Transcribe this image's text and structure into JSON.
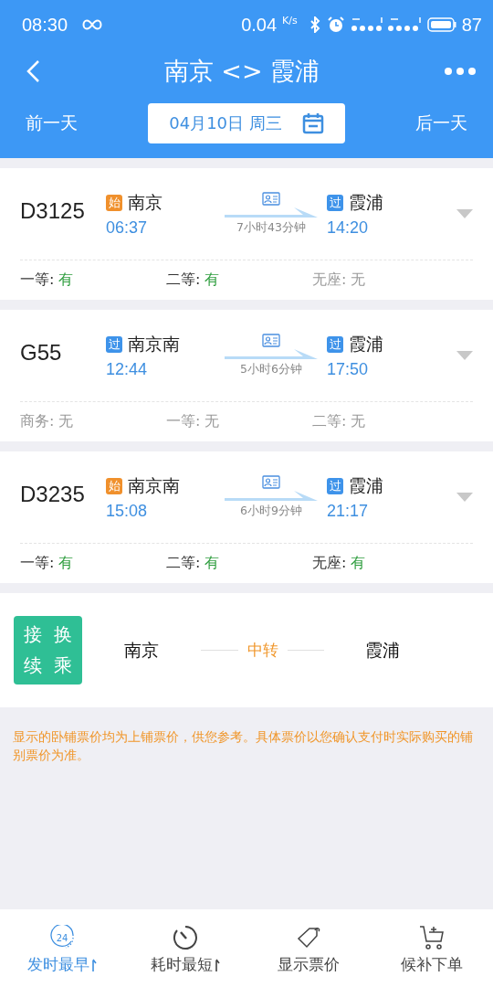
{
  "status_bar": {
    "time": "08:30",
    "speed": "0.04",
    "speed_unit": "K/s",
    "battery": "87"
  },
  "header": {
    "title": "南京 <> 霞浦"
  },
  "date_bar": {
    "prev": "前一天",
    "date": "04月10日 周三",
    "next": "后一天"
  },
  "trains": [
    {
      "number": "D3125",
      "from": {
        "badge": "始",
        "kind": "start",
        "station": "南京",
        "time": "06:37"
      },
      "duration": "7小时43分钟",
      "to": {
        "badge": "过",
        "kind": "pass",
        "station": "霞浦",
        "time": "14:20"
      },
      "seats": [
        {
          "label": "一等:",
          "value": "有",
          "available": true
        },
        {
          "label": "二等:",
          "value": "有",
          "available": true
        },
        {
          "label": "无座:",
          "value": "无",
          "available": false
        }
      ]
    },
    {
      "number": "G55",
      "from": {
        "badge": "过",
        "kind": "pass",
        "station": "南京南",
        "time": "12:44"
      },
      "duration": "5小时6分钟",
      "to": {
        "badge": "过",
        "kind": "pass",
        "station": "霞浦",
        "time": "17:50"
      },
      "seats": [
        {
          "label": "商务:",
          "value": "无",
          "available": false
        },
        {
          "label": "一等:",
          "value": "无",
          "available": false
        },
        {
          "label": "二等:",
          "value": "无",
          "available": false
        }
      ]
    },
    {
      "number": "D3235",
      "from": {
        "badge": "始",
        "kind": "start",
        "station": "南京南",
        "time": "15:08"
      },
      "duration": "6小时9分钟",
      "to": {
        "badge": "过",
        "kind": "pass",
        "station": "霞浦",
        "time": "21:17"
      },
      "seats": [
        {
          "label": "一等:",
          "value": "有",
          "available": true
        },
        {
          "label": "二等:",
          "value": "有",
          "available": true
        },
        {
          "label": "无座:",
          "value": "有",
          "available": true
        }
      ]
    }
  ],
  "transfer": {
    "badge": [
      "接",
      "换",
      "续",
      "乘"
    ],
    "from": "南京",
    "via": "中转",
    "to": "霞浦"
  },
  "note": "显示的卧铺票价均为上铺票价，供您参考。具体票价以您确认支付时实际购买的铺别票价为准。",
  "bottom_tabs": [
    {
      "label": "发时最早",
      "kind": "clock24",
      "icon_text": "24",
      "sortable": true,
      "selected": true
    },
    {
      "label": "耗时最短",
      "kind": "timer",
      "sortable": true,
      "selected": false
    },
    {
      "label": "显示票价",
      "kind": "tag",
      "sortable": false,
      "selected": false
    },
    {
      "label": "候补下单",
      "kind": "cart",
      "sortable": false,
      "selected": false
    }
  ]
}
